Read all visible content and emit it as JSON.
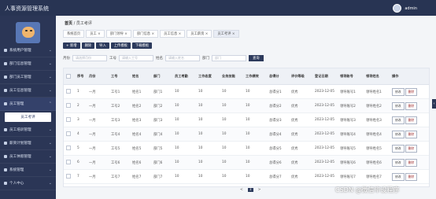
{
  "app_title": "人事资源管理系统",
  "user": {
    "name": "admin"
  },
  "sidebar": {
    "items": [
      {
        "label": "系统用户管理"
      },
      {
        "label": "部门信息管理"
      },
      {
        "label": "部门员工管理"
      },
      {
        "label": "员工信息管理"
      },
      {
        "label": "员工管理",
        "active": true,
        "sub": "员工考评"
      },
      {
        "label": "员工培训管理"
      },
      {
        "label": "薪资计划管理"
      },
      {
        "label": "员工休假管理"
      },
      {
        "label": "系统管理"
      },
      {
        "label": "个人中心"
      }
    ]
  },
  "breadcrumb": {
    "home": "首页",
    "sep": "/",
    "current": "员工考评"
  },
  "tabs": [
    {
      "label": "系统首页"
    },
    {
      "label": "员工 ×"
    },
    {
      "label": "部门领导 ×"
    },
    {
      "label": "部门信息 ×"
    },
    {
      "label": "员工信息 ×"
    },
    {
      "label": "员工薪资 ×"
    },
    {
      "label": "员工考评 ×",
      "active": true
    }
  ],
  "toolbar": {
    "add": "+ 新增",
    "delete": "删除",
    "import": "导入",
    "upload": "上传模板",
    "download": "下载模板"
  },
  "filter": {
    "company_label": "月份",
    "company_placeholder": "请选择月份",
    "job_no_label": "工号",
    "job_no_placeholder": "请输入工号",
    "name_label": "姓名",
    "name_placeholder": "请输入姓名",
    "dept_label": "部门",
    "dept_placeholder": "部门",
    "search_btn": "查询"
  },
  "table": {
    "headers": [
      "序号",
      "月份",
      "工号",
      "姓名",
      "部门",
      "员工考勤",
      "工作态度",
      "业务技能",
      "工作绩效",
      "总得分",
      "评价等级",
      "登记日期",
      "领导账号",
      "领导姓名",
      "操作"
    ],
    "rows": [
      [
        "1",
        "一月",
        "工号1",
        "姓名1",
        "部门1",
        "10",
        "10",
        "10",
        "10",
        "总得分1",
        "优秀",
        "2023-12-05",
        "领导账号1",
        "领导姓名1"
      ],
      [
        "2",
        "一月",
        "工号2",
        "姓名2",
        "部门2",
        "10",
        "10",
        "10",
        "10",
        "总得分2",
        "优秀",
        "2023-12-05",
        "领导账号2",
        "领导姓名2"
      ],
      [
        "3",
        "一月",
        "工号3",
        "姓名3",
        "部门3",
        "10",
        "10",
        "10",
        "10",
        "总得分3",
        "优秀",
        "2023-12-05",
        "领导账号3",
        "领导姓名3"
      ],
      [
        "4",
        "一月",
        "工号4",
        "姓名4",
        "部门4",
        "10",
        "10",
        "10",
        "10",
        "总得分4",
        "优秀",
        "2023-12-05",
        "领导账号4",
        "领导姓名4"
      ],
      [
        "5",
        "一月",
        "工号5",
        "姓名5",
        "部门5",
        "10",
        "10",
        "10",
        "10",
        "总得分5",
        "优秀",
        "2023-12-05",
        "领导账号5",
        "领导姓名5"
      ],
      [
        "6",
        "一月",
        "工号6",
        "姓名6",
        "部门6",
        "10",
        "10",
        "10",
        "10",
        "总得分6",
        "优秀",
        "2023-12-05",
        "领导账号6",
        "领导姓名6"
      ],
      [
        "7",
        "一月",
        "工号7",
        "姓名7",
        "部门7",
        "10",
        "10",
        "10",
        "10",
        "总得分7",
        "优秀",
        "2023-12-05",
        "领导账号7",
        "领导姓名7"
      ]
    ],
    "actions": {
      "edit": "修改",
      "delete": "删除"
    }
  },
  "pager": {
    "prev": "<",
    "page": "1",
    "next": ">"
  },
  "watermark": "CSDN @微信毕设程序",
  "colors": {
    "nav": "#2b3656",
    "accent": "#2c3a5c"
  }
}
